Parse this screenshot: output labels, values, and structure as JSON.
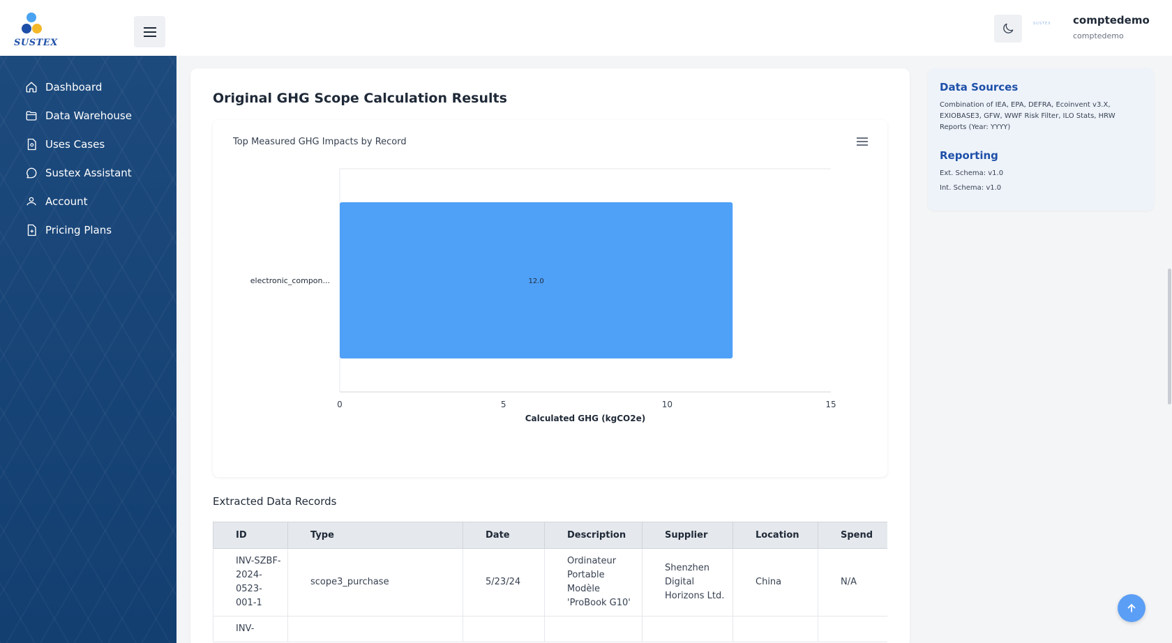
{
  "brand": {
    "name": "SUSTEX",
    "subtitle": ""
  },
  "header": {
    "user_name": "comptedemo",
    "user_sub": "comptedemo",
    "avatar_text": "SUSTEX"
  },
  "sidebar": {
    "items": [
      {
        "label": "Dashboard"
      },
      {
        "label": "Data Warehouse"
      },
      {
        "label": "Uses Cases"
      },
      {
        "label": "Sustex Assistant"
      },
      {
        "label": "Account"
      },
      {
        "label": "Pricing Plans"
      }
    ]
  },
  "main": {
    "title": "Original GHG Scope Calculation Results",
    "records_title": "Extracted Data Records",
    "table": {
      "columns": [
        "ID",
        "Type",
        "Date",
        "Description",
        "Supplier",
        "Location",
        "Spend"
      ],
      "rows": [
        [
          "INV-SZBF-2024-0523-001-1",
          "scope3_purchase",
          "5/23/24",
          "Ordinateur Portable Modèle 'ProBook G10'",
          "Shenzhen Digital Horizons Ltd.",
          "China",
          "N/A"
        ],
        [
          "INV-",
          "",
          "",
          "",
          "",
          "",
          ""
        ]
      ]
    }
  },
  "chart_data": {
    "type": "bar",
    "orientation": "horizontal",
    "title": "Top Measured GHG Impacts by Record",
    "categories": [
      "electronic_compon..."
    ],
    "values": [
      12.0
    ],
    "data_labels": [
      "12.0"
    ],
    "xlabel": "Calculated GHG (kgCO2e)",
    "ylabel": "",
    "xlim": [
      0,
      15
    ],
    "xticks": [
      0,
      5,
      10,
      15
    ],
    "grid": false,
    "bar_color": "#4fa0f7"
  },
  "right_panel": {
    "data_sources_title": "Data Sources",
    "data_sources_text": "Combination of IEA, EPA, DEFRA, Ecoinvent v3.X, EXIOBASE3, GFW, WWF Risk Filter, ILO Stats, HRW Reports (Year: YYYY)",
    "reporting_title": "Reporting",
    "ext_schema": "Ext. Schema: v1.0",
    "int_schema": "Int. Schema: v1.0"
  },
  "colors": {
    "accent": "#1e4fa8",
    "sidebar": "#1a4579",
    "bar": "#4fa0f7",
    "scroll_button": "#5b9ef5"
  },
  "icons": {
    "menu": "hamburger-icon",
    "theme": "moon-icon",
    "chart_menu": "menu-icon",
    "scroll_up": "arrow-up-icon"
  }
}
